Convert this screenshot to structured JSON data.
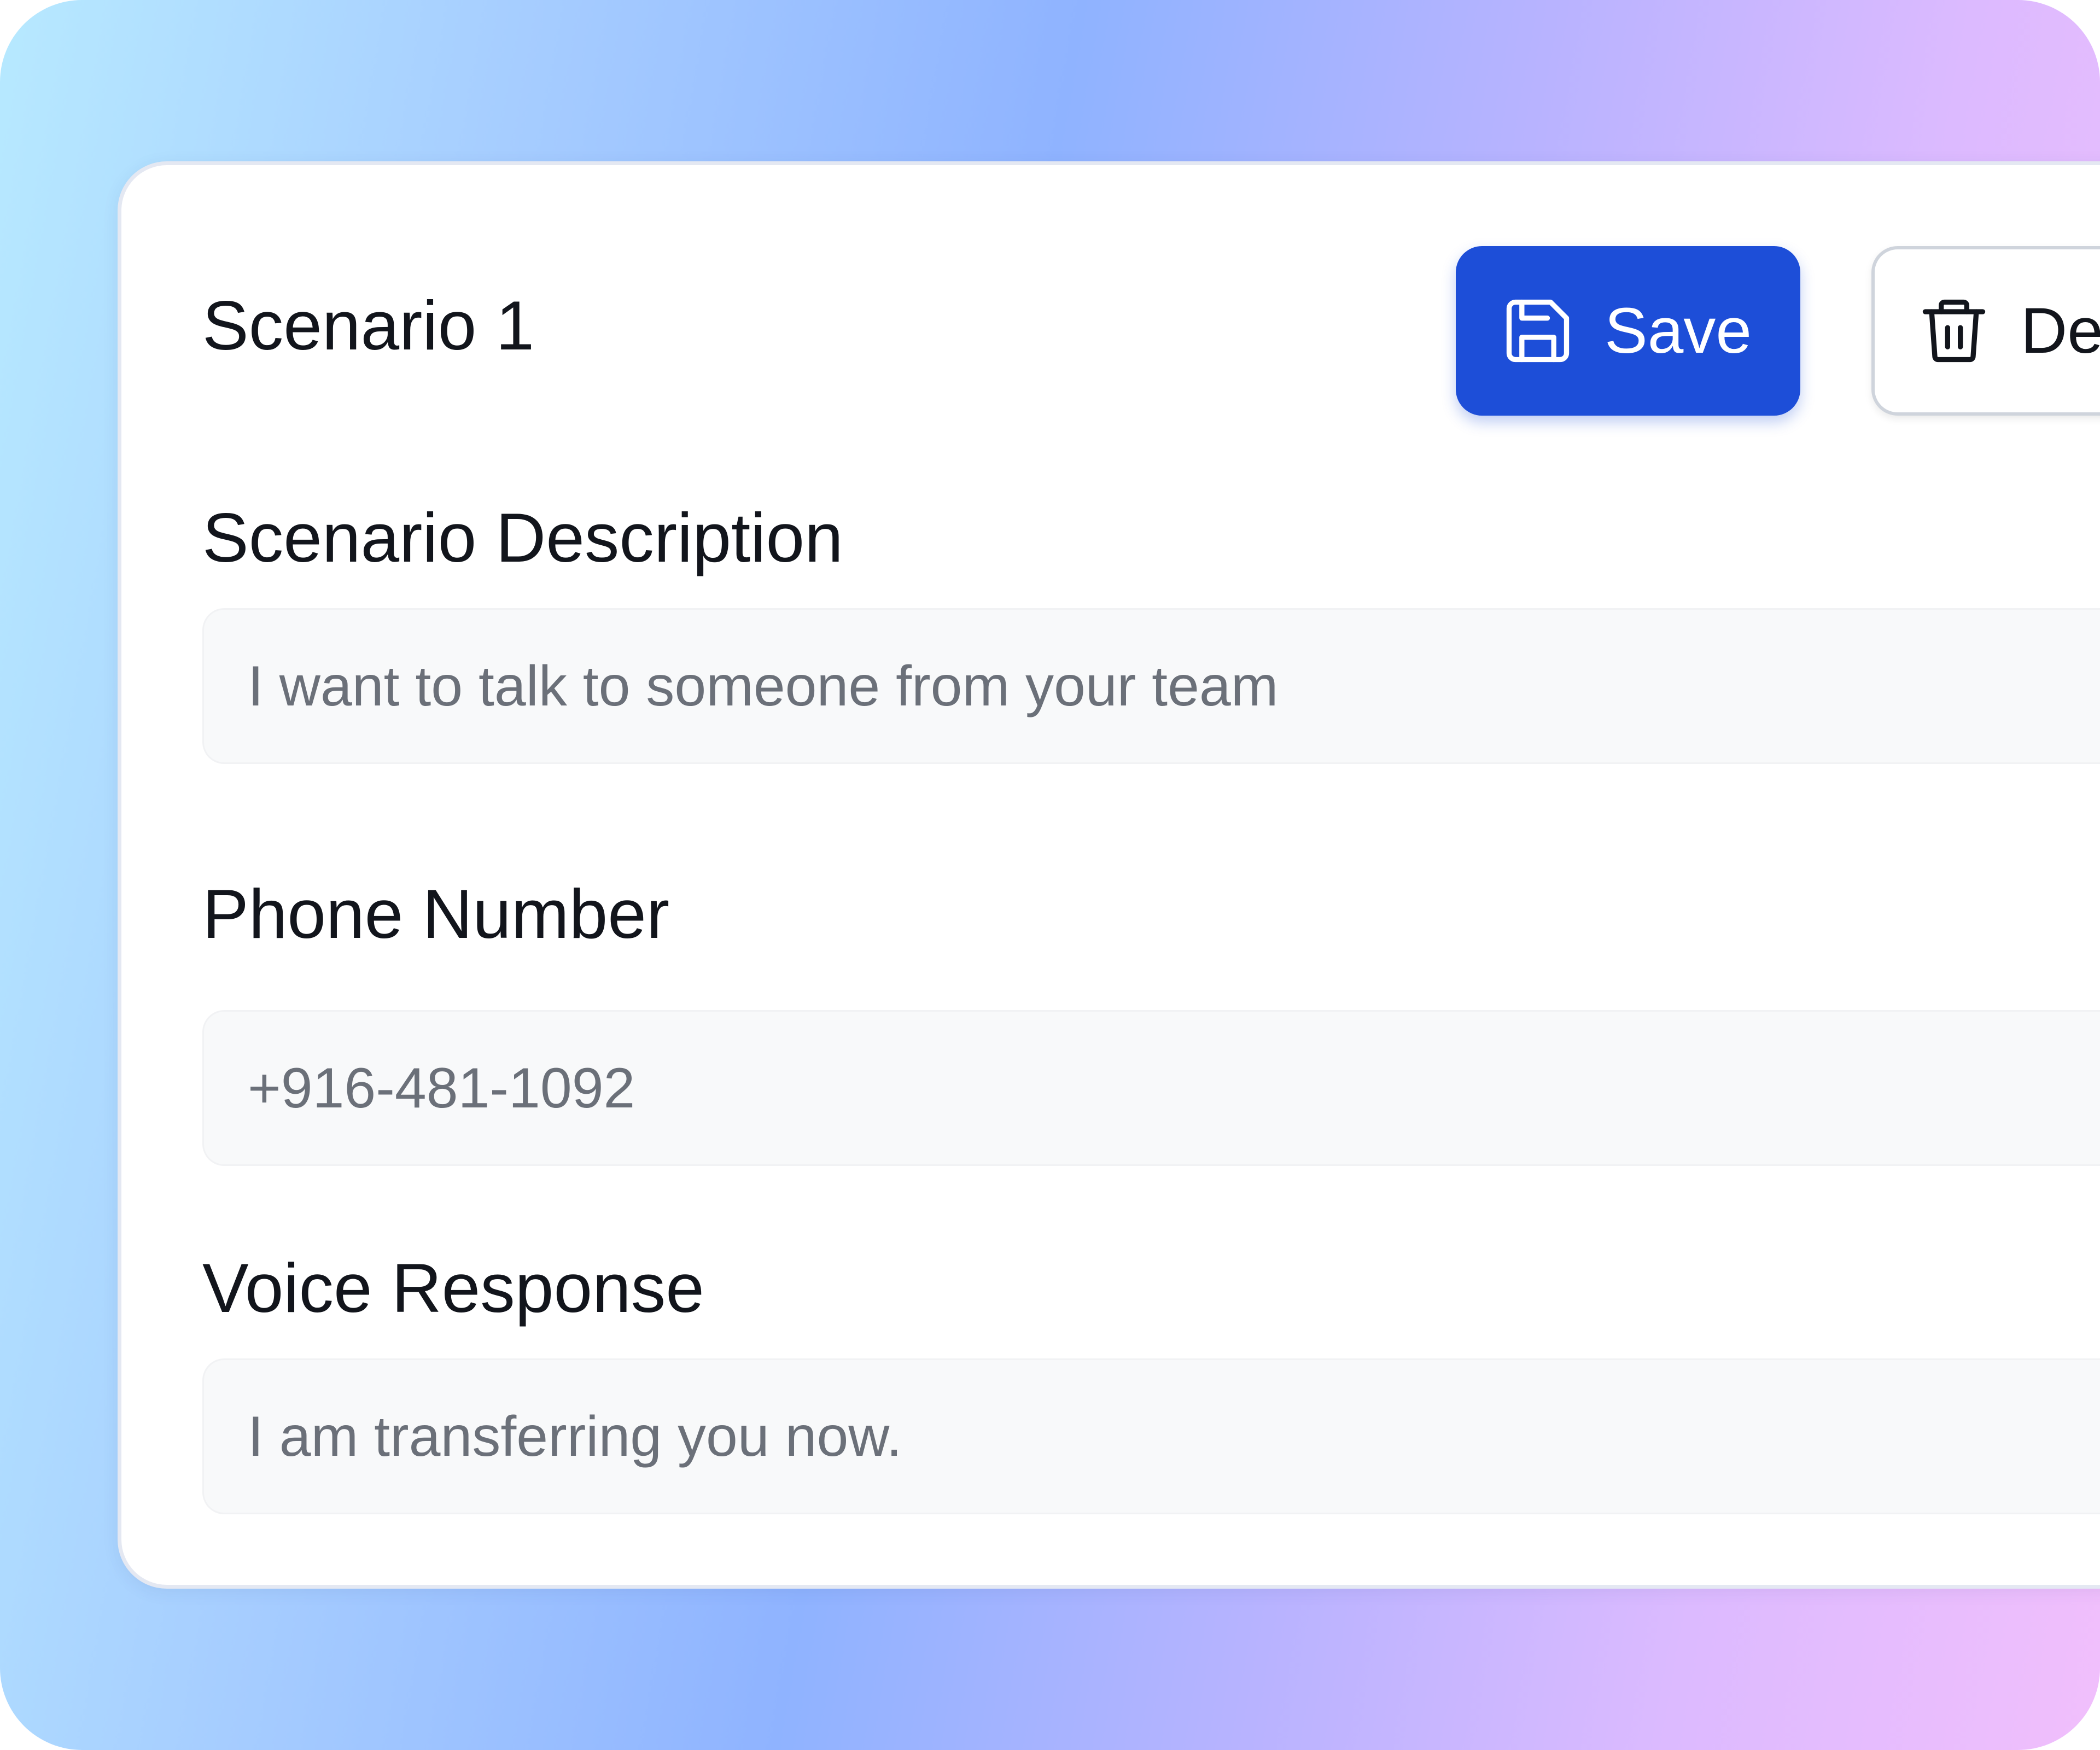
{
  "card": {
    "title": "Scenario 1"
  },
  "toolbar": {
    "save_label": "Save",
    "delete_label": "De",
    "primary_color": "#1d4ed8"
  },
  "fields": {
    "description": {
      "label": "Scenario Description",
      "placeholder": "I want to talk to someone from your team"
    },
    "phone": {
      "label": "Phone Number",
      "placeholder": "+916-481-1092"
    },
    "voice": {
      "label": "Voice Response",
      "placeholder": "I am transferring you now."
    }
  },
  "icons": {
    "save": "save-icon",
    "delete": "trash-icon"
  }
}
